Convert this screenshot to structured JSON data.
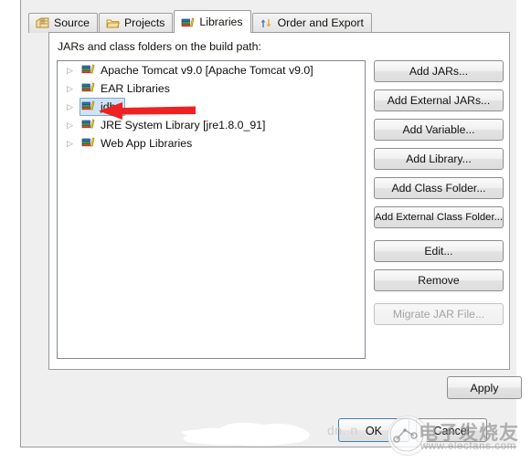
{
  "dialog": {
    "tabs": [
      {
        "label": "Source",
        "icon": "package-icon",
        "active": false
      },
      {
        "label": "Projects",
        "icon": "folder-icon",
        "active": false
      },
      {
        "label": "Libraries",
        "icon": "books-icon",
        "active": true
      },
      {
        "label": "Order and Export",
        "icon": "order-arrows-icon",
        "active": false
      }
    ],
    "panel_title": "JARs and class folders on the build path:",
    "tree": {
      "items": [
        {
          "label": "Apache Tomcat v9.0 [Apache Tomcat v9.0]",
          "icon": "library-icon",
          "expander": "▷",
          "selected": false
        },
        {
          "label": "EAR Libraries",
          "icon": "library-icon",
          "expander": "▷",
          "selected": false
        },
        {
          "label": "jdbc",
          "icon": "library-icon",
          "expander": "▷",
          "selected": true
        },
        {
          "label": "JRE System Library [jre1.8.0_91]",
          "icon": "library-icon",
          "expander": "▷",
          "selected": false
        },
        {
          "label": "Web App Libraries",
          "icon": "library-icon",
          "expander": "▷",
          "selected": false
        }
      ]
    },
    "buttons": [
      {
        "label": "Add JARs...",
        "enabled": true
      },
      {
        "label": "Add External JARs...",
        "enabled": true
      },
      {
        "label": "Add Variable...",
        "enabled": true
      },
      {
        "label": "Add Library...",
        "enabled": true
      },
      {
        "label": "Add Class Folder...",
        "enabled": true
      },
      {
        "label": "Add External Class Folder...",
        "enabled": true
      },
      {
        "label": "Edit...",
        "enabled": true
      },
      {
        "label": "Remove",
        "enabled": true
      },
      {
        "label": "Migrate JAR File...",
        "enabled": false
      }
    ],
    "apply_label": "Apply",
    "ok_label": "OK",
    "cancel_label": "Cancel"
  },
  "annotation": {
    "arrow_color": "#ee2222",
    "points_to": "jdbc"
  },
  "watermark": {
    "text_cn": "电子发烧友",
    "url": "www.elecfans.com",
    "faint_text": "dn. n"
  },
  "colors": {
    "dialog_background": "#efefef",
    "panel_background": "#ffffff",
    "selection_fill": "#cfe3f7",
    "selection_border": "#7aa7d4",
    "focus_border": "#3c7fb1"
  }
}
